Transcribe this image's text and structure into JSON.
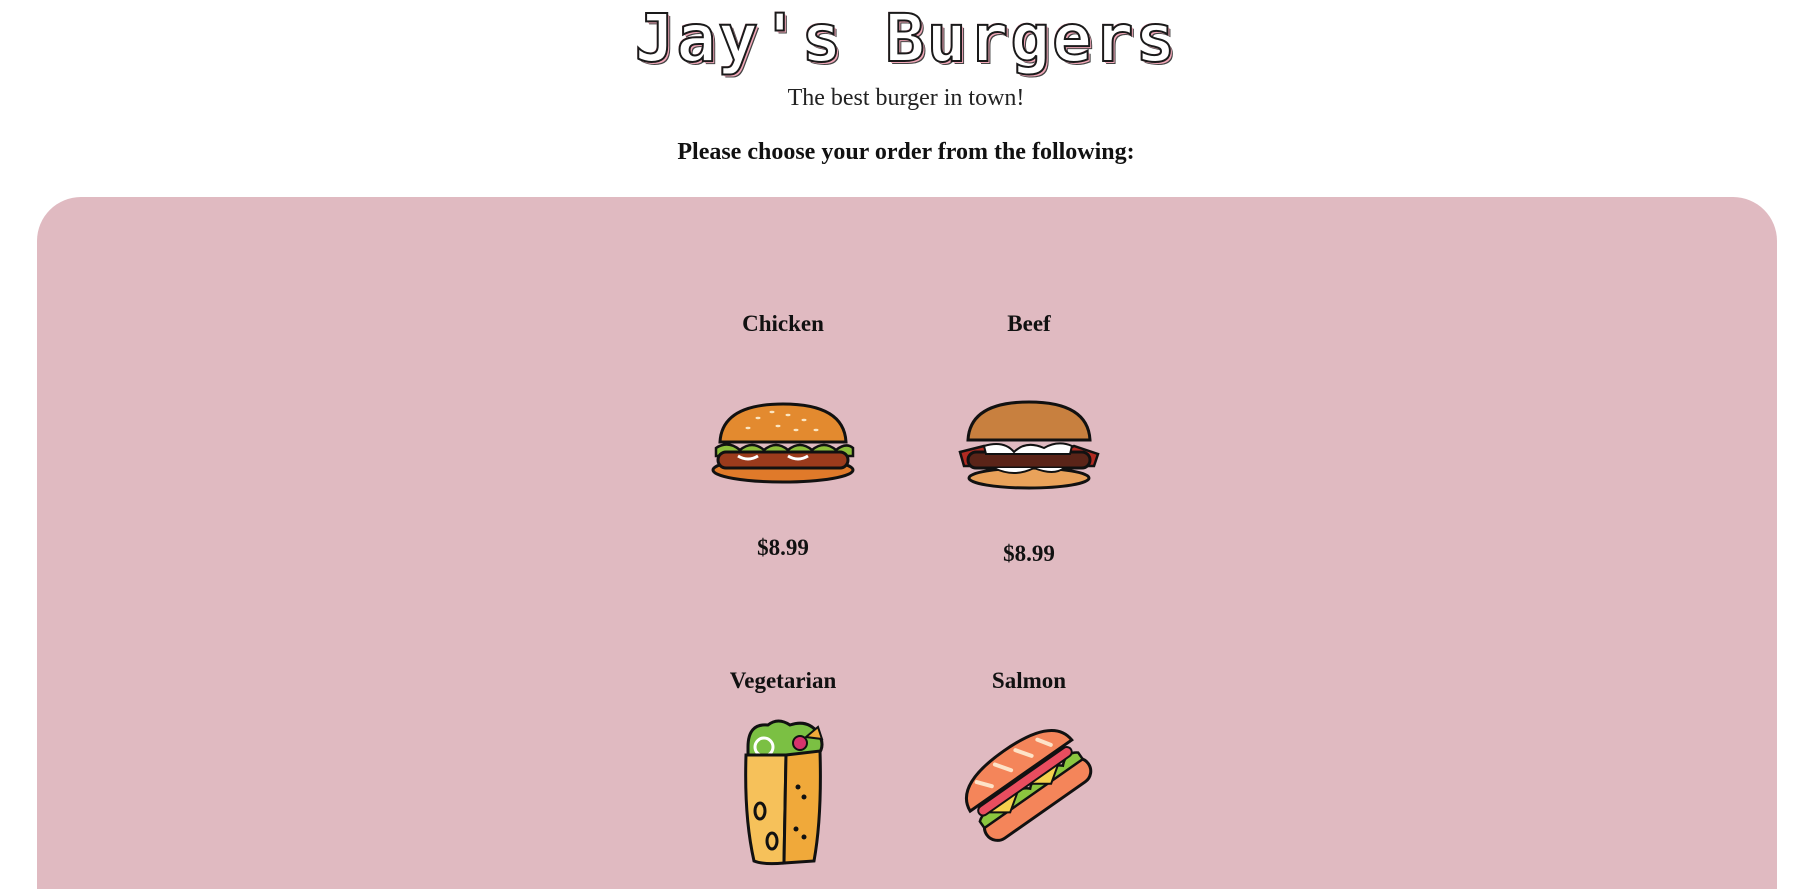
{
  "header": {
    "title": "Jay's Burgers",
    "tagline": "The best burger in town!",
    "instructions": "Please choose your order from the following:"
  },
  "menu": {
    "items": [
      {
        "name": "Chicken",
        "price": "$8.99",
        "icon": "chicken-burger-icon"
      },
      {
        "name": "Beef",
        "price": "$8.99",
        "icon": "beef-burger-icon"
      },
      {
        "name": "Vegetarian",
        "icon": "vegetarian-wrap-icon"
      },
      {
        "name": "Salmon",
        "icon": "salmon-sandwich-icon"
      }
    ]
  },
  "colors": {
    "panel_background": "#e0bac1",
    "title_accent": "#f2a7b8"
  }
}
